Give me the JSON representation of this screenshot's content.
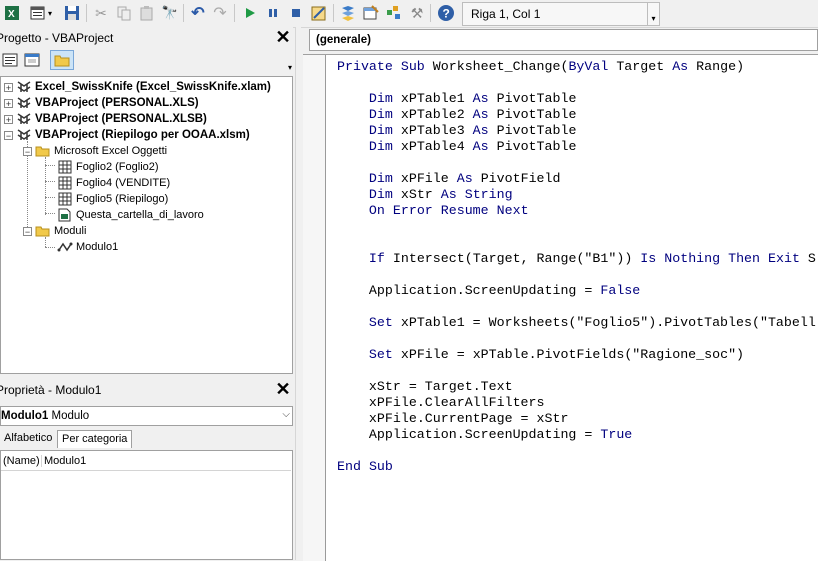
{
  "toolbar": {
    "status": "Riga 1, Col 1"
  },
  "project_panel": {
    "title": "Progetto - VBAProject",
    "close": "✕",
    "tree": [
      {
        "label": "Excel_SwissKnife (Excel_SwissKnife.xlam)",
        "bold": true,
        "expander": "+"
      },
      {
        "label": "VBAProject (PERSONAL.XLS)",
        "bold": true,
        "expander": "+"
      },
      {
        "label": "VBAProject (PERSONAL.XLSB)",
        "bold": true,
        "expander": "+"
      },
      {
        "label": "VBAProject (Riepilogo per OOAA.xlsm)",
        "bold": true,
        "expander": "−"
      },
      {
        "label": "Microsoft Excel Oggetti",
        "bold": false,
        "expander": "−"
      },
      {
        "label": "Foglio2 (Foglio2)",
        "bold": false
      },
      {
        "label": "Foglio4 (VENDITE)",
        "bold": false
      },
      {
        "label": "Foglio5 (Riepilogo)",
        "bold": false
      },
      {
        "label": "Questa_cartella_di_lavoro",
        "bold": false
      },
      {
        "label": "Moduli",
        "bold": false,
        "expander": "−"
      },
      {
        "label": "Modulo1",
        "bold": false
      }
    ]
  },
  "properties_panel": {
    "title": "Proprietà - Modulo1",
    "close": "✕",
    "object_name": "Modulo1",
    "object_type": "Modulo",
    "tabs": [
      "Alfabetico",
      "Per categoria"
    ],
    "rows": [
      {
        "name": "(Name)",
        "value": "Modulo1"
      }
    ]
  },
  "code_window": {
    "object_combo": "(generale)",
    "lines": [
      "Private Sub Worksheet_Change(ByVal Target As Range)",
      "",
      "    Dim xPTable1 As PivotTable",
      "    Dim xPTable2 As PivotTable",
      "    Dim xPTable3 As PivotTable",
      "    Dim xPTable4 As PivotTable",
      "",
      "    Dim xPFile As PivotField",
      "    Dim xStr As String",
      "    On Error Resume Next",
      "",
      "",
      "    If Intersect(Target, Range(\"B1\")) Is Nothing Then Exit S",
      "",
      "    Application.ScreenUpdating = False",
      "",
      "    Set xPTable1 = Worksheets(\"Foglio5\").PivotTables(\"Tabell",
      "",
      "    Set xPFile = xPTable.PivotFields(\"Ragione_soc\")",
      "",
      "    xStr = Target.Text",
      "    xPFile.ClearAllFilters",
      "    xPFile.CurrentPage = xStr",
      "    Application.ScreenUpdating = True",
      "",
      "End Sub"
    ]
  },
  "colors": {
    "keyword": "#00007f",
    "background": "#f0f0f0"
  }
}
